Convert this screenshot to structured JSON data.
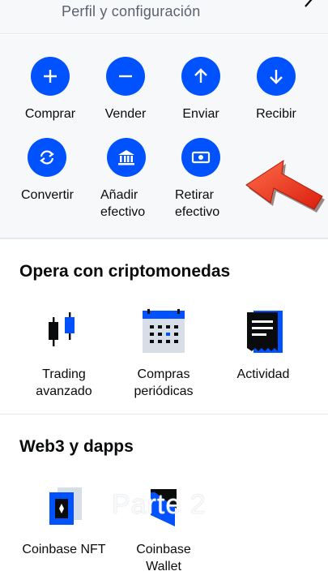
{
  "header": {
    "title": "Perfil y configuración"
  },
  "actions": [
    {
      "label": "Comprar",
      "icon": "plus-icon"
    },
    {
      "label": "Vender",
      "icon": "minus-icon"
    },
    {
      "label": "Enviar",
      "icon": "arrow-up-icon"
    },
    {
      "label": "Recibir",
      "icon": "arrow-down-icon"
    },
    {
      "label": "Convertir",
      "icon": "convert-icon"
    },
    {
      "label": "Añadir\nefectivo",
      "icon": "bank-icon"
    },
    {
      "label": "Retirar\nefectivo",
      "icon": "cash-icon"
    }
  ],
  "trade": {
    "title": "Opera con criptomonedas",
    "items": [
      {
        "label": "Trading\navanzado",
        "icon": "candlestick-icon"
      },
      {
        "label": "Compras\nperiódicas",
        "icon": "calendar-icon"
      },
      {
        "label": "Actividad",
        "icon": "receipt-icon"
      }
    ]
  },
  "web3": {
    "title": "Web3 y dapps",
    "items": [
      {
        "label": "Coinbase NFT",
        "icon": "nft-card-icon"
      },
      {
        "label": "Coinbase\nWallet",
        "icon": "wallet-icon"
      }
    ]
  },
  "overlay": {
    "watermark": "Parte 2"
  },
  "colors": {
    "accent": "#0052ff",
    "arrow": "#e8321e",
    "background": "#f7f8fa"
  }
}
